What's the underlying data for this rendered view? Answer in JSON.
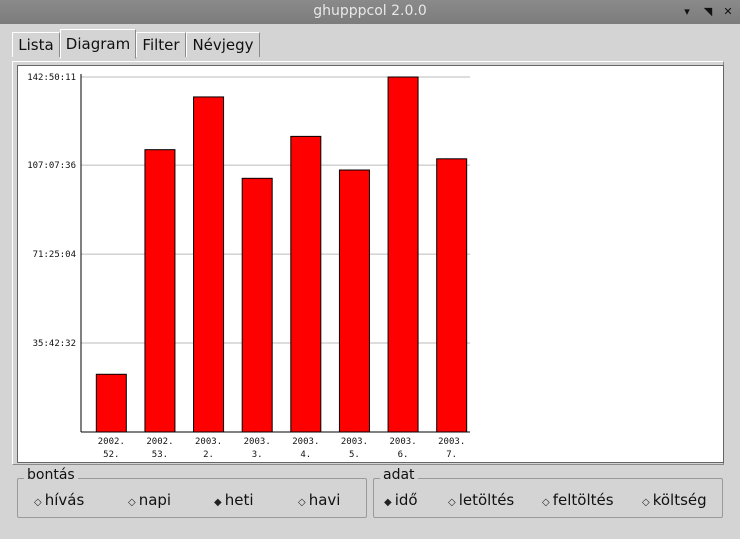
{
  "window": {
    "title": "ghupppcol 2.0.0"
  },
  "tabs": [
    "Lista",
    "Diagram",
    "Filter",
    "Névjegy"
  ],
  "chart_data": {
    "type": "bar",
    "categories": [
      "2002.\n52.",
      "2002.\n53.",
      "2003.\n2.",
      "2003.\n3.",
      "2003.\n4.",
      "2003.\n5.",
      "2003.\n6.",
      "2003.\n7."
    ],
    "category_lines": [
      [
        "2002.",
        "52."
      ],
      [
        "2002.",
        "53."
      ],
      [
        "2003.",
        "2."
      ],
      [
        "2003.",
        "3."
      ],
      [
        "2003.",
        "4."
      ],
      [
        "2003.",
        "5."
      ],
      [
        "2003.",
        "6."
      ],
      [
        "2003.",
        "7."
      ]
    ],
    "values_seconds": [
      83400,
      408000,
      484200,
      366600,
      427200,
      378600,
      513011,
      394800
    ],
    "ylim_seconds": [
      0,
      513011
    ],
    "yticks": [
      {
        "value": 128603,
        "label": "35:42:32"
      },
      {
        "value": 257104,
        "label": "71:25:04"
      },
      {
        "value": 385596,
        "label": "107:07:36"
      },
      {
        "value": 513011,
        "label": "142:50:11"
      }
    ],
    "bar_color": "#ff0000",
    "grid": true,
    "title": "",
    "xlabel": "",
    "ylabel": ""
  },
  "groups": {
    "bontas": {
      "label": "bontás",
      "options": [
        "hívás",
        "napi",
        "heti",
        "havi"
      ],
      "selected": "heti"
    },
    "adat": {
      "label": "adat",
      "options": [
        "idő",
        "letöltés",
        "feltöltés",
        "költség"
      ],
      "selected": "idő"
    }
  }
}
